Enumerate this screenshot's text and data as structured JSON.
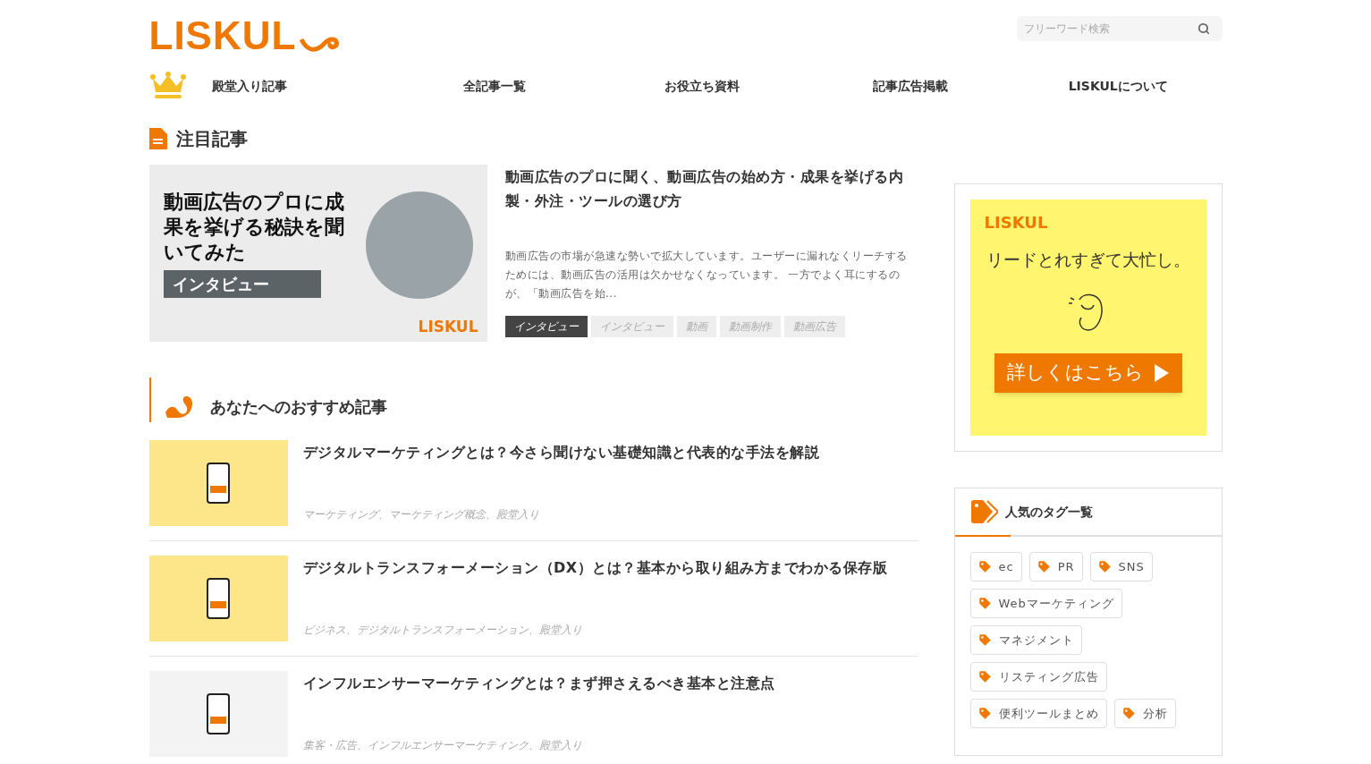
{
  "header": {
    "logo": "LISKUL",
    "search": {
      "placeholder": "フリーワード検索"
    }
  },
  "nav": [
    "殿堂入り記事",
    "全記事一覧",
    "お役立ち資料",
    "記事広告掲載",
    "LISKULについて"
  ],
  "featured": {
    "heading": "注目記事",
    "image": {
      "headline": "動画広告のプロに成果を挙げる秘訣を聞いてみた",
      "badge": "インタビュー",
      "brand": "LISKUL"
    },
    "title": "動画広告のプロに聞く、動画広告の始め方・成果を挙げる内製・外注・ツールの選び方",
    "excerpt": "動画広告の市場が急速な勢いで拡大しています。ユーザーに漏れなくリーチするためには、動画広告の活用は欠かせなくなっています。 一方でよく耳にするのが、「動画広告を始...",
    "tags": [
      {
        "label": "インタビュー",
        "selected": true
      },
      {
        "label": "インタビュー",
        "selected": false
      },
      {
        "label": "動画",
        "selected": false
      },
      {
        "label": "動画制作",
        "selected": false
      },
      {
        "label": "動画広告",
        "selected": false
      }
    ]
  },
  "recommended": {
    "heading": "あなたへのおすすめ記事",
    "articles": [
      {
        "title": "デジタルマーケティングとは？今さら聞けない基礎知識と代表的な手法を解説",
        "categories": "マーケティング、マーケティング概念、殿堂入り"
      },
      {
        "title": "デジタルトランスフォーメーション（DX）とは？基本から取り組み方までわかる保存版",
        "categories": "ビジネス、デジタルトランスフォーメーション、殿堂入り"
      },
      {
        "title": "インフルエンサーマーケティングとは？まず押さえるべき基本と注意点",
        "categories": "集客・広告、インフルエンサーマーケティンク、殿堂入り"
      }
    ]
  },
  "ad": {
    "brand": "LISKUL",
    "tagline": "リードとれすぎて大忙し。",
    "button": "詳しくはこちら"
  },
  "popular_tags": {
    "heading": "人気のタグ一覧",
    "tags": [
      "ec",
      "PR",
      "SNS",
      "Webマーケティング",
      "マネジメント",
      "リスティング広告",
      "便利ツールまとめ",
      "分析"
    ]
  }
}
